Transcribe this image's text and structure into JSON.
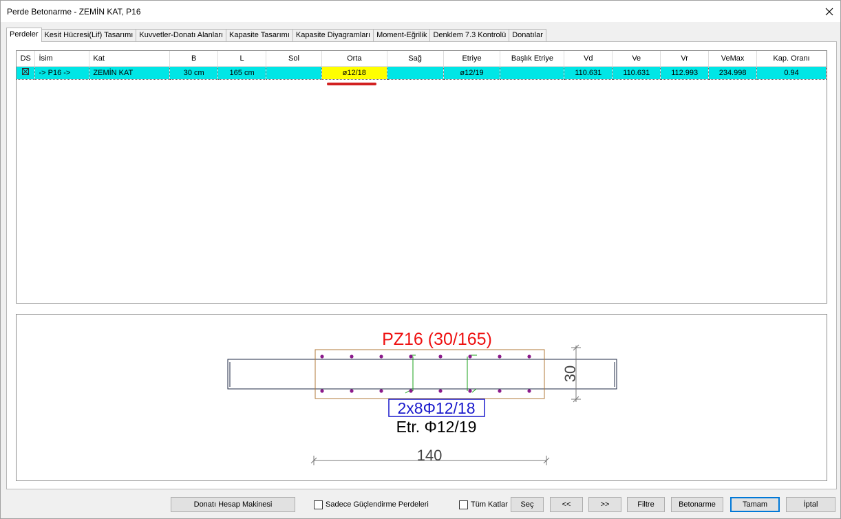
{
  "window": {
    "title": "Perde Betonarme - ZEMİN KAT, P16"
  },
  "tabs": [
    "Perdeler",
    "Kesit Hücresi(Lif) Tasarımı",
    "Kuvvetler-Donatı Alanları",
    "Kapasite Tasarımı",
    "Kapasite Diyagramları",
    "Moment-Eğrilik",
    "Denklem 7.3 Kontrolü",
    "Donatılar"
  ],
  "active_tab": "Perdeler",
  "table": {
    "columns": [
      "DS",
      "İsim",
      "Kat",
      "B",
      "L",
      "Sol",
      "Orta",
      "Sağ",
      "Etriye",
      "Başlık Etriye",
      "Vd",
      "Ve",
      "Vr",
      "VeMax",
      "Kap. Oranı"
    ],
    "rows": [
      {
        "ds_checked": true,
        "isim": "-> P16 ->",
        "kat": "ZEMİN KAT",
        "b": "30 cm",
        "l": "165 cm",
        "sol": "",
        "orta": "ø12/18",
        "sag": "",
        "etriye": "ø12/19",
        "baslik_etriye": "",
        "vd": "110.631",
        "ve": "110.631",
        "vr": "112.993",
        "vemax": "234.998",
        "kap_orani": "0.94"
      }
    ],
    "highlight_color": "#00e6e6",
    "cell_highlight_color": "#ffff00"
  },
  "drawing": {
    "title": "PZ16 (30/165)",
    "rebar_label": "2x8Φ12/18",
    "stirrup_label": "Etr. Φ12/19",
    "dim_width": "140",
    "dim_height": "30",
    "title_color": "#ee1111",
    "rebar_label_color": "#1a1acc",
    "rebar_dot_color": "#8b1a8b"
  },
  "bottom": {
    "donati_hesap": "Donatı Hesap Makinesi",
    "sadece_guclendirme": "Sadece Güçlendirme Perdeleri",
    "tum_katlar": "Tüm Katlar",
    "sec": "Seç",
    "prev": "<<",
    "next": ">>",
    "filtre": "Filtre",
    "betonarme": "Betonarme",
    "tamam": "Tamam",
    "iptal": "İptal"
  }
}
